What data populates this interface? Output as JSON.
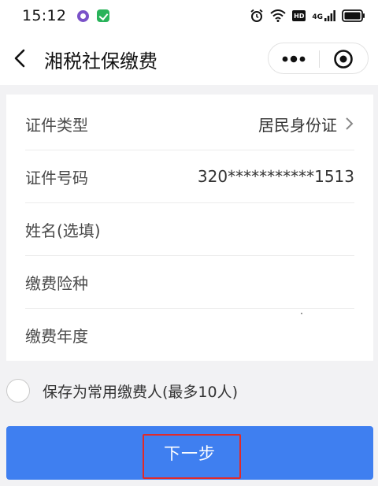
{
  "status_bar": {
    "time": "15:12",
    "hd": "HD",
    "network": "4G"
  },
  "nav": {
    "title": "湘税社保缴费"
  },
  "form": {
    "rows": [
      {
        "label": "证件类型",
        "value": "居民身份证",
        "has_chevron": true
      },
      {
        "label": "证件号码",
        "value": "320***********1513",
        "has_chevron": false
      },
      {
        "label": "姓名(选填)",
        "value": "",
        "has_chevron": false
      },
      {
        "label": "缴费险种",
        "value": "",
        "has_chevron": false
      },
      {
        "label": "缴费年度",
        "value": "",
        "has_chevron": false
      }
    ]
  },
  "save_option": {
    "label": "保存为常用缴费人(最多10人)",
    "checked": false
  },
  "next_button": {
    "label": "下一步"
  },
  "colors": {
    "primary": "#3f7ff0",
    "highlight": "#e02a2a",
    "background": "#f2f2f4"
  }
}
